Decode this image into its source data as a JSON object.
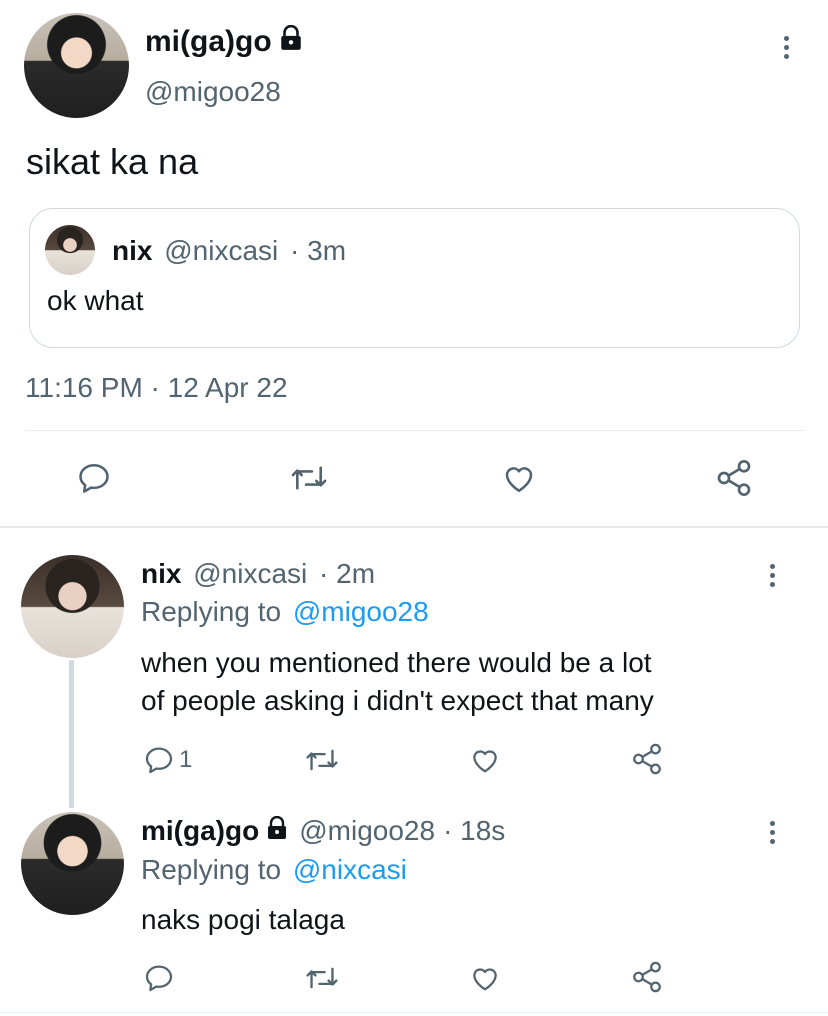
{
  "main_tweet": {
    "author_name": "mi(ga)go",
    "author_handle": "@migoo28",
    "text": "sikat ka na",
    "quoted": {
      "author_name": "nix",
      "author_handle": "@nixcasi",
      "time": "· 3m",
      "text": "ok what"
    },
    "timestamp": "11:16 PM · 12 Apr 22"
  },
  "replies": [
    {
      "author_name": "nix",
      "author_handle": "@nixcasi",
      "time": "· 2m",
      "replying_prefix": "Replying to",
      "replying_to": "@migoo28",
      "text_line1": "when you mentioned there would be a lot",
      "text_line2": "of people asking i didn't expect that many",
      "reply_count": "1"
    },
    {
      "author_name": "mi(ga)go",
      "author_handle": "@migoo28",
      "time": "· 18s",
      "replying_prefix": "Replying to",
      "replying_to": "@nixcasi",
      "text": "naks pogi talaga"
    }
  ],
  "icons": {
    "reply": "speech-bubble-icon",
    "retweet": "retweet-arrows-icon",
    "like": "heart-icon",
    "share": "share-nodes-icon",
    "more": "vertical-dots-icon",
    "protected": "lock-icon"
  },
  "colors": {
    "text": "#0f1419",
    "muted": "#536471",
    "link": "#1d9bf0",
    "border": "#cfd9de"
  }
}
